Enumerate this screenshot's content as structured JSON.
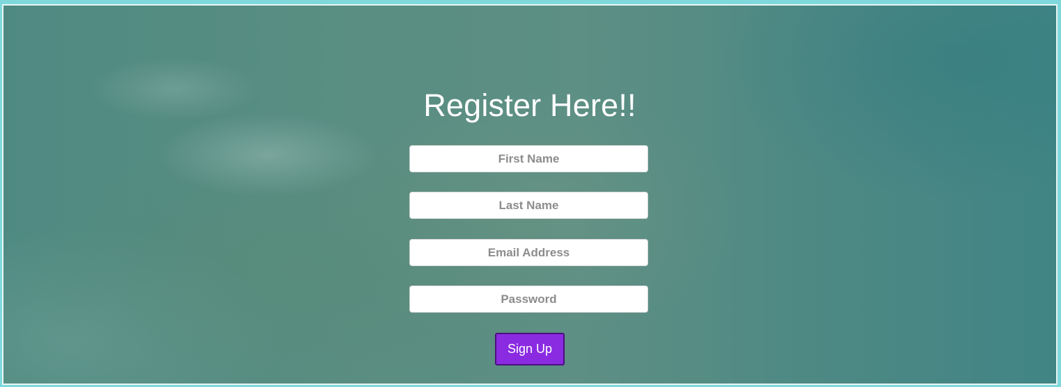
{
  "form": {
    "title": "Register Here!!",
    "fields": [
      {
        "placeholder": "First Name",
        "value": ""
      },
      {
        "placeholder": "Last Name",
        "value": ""
      },
      {
        "placeholder": "Email Address",
        "value": ""
      },
      {
        "placeholder": "Password",
        "value": ""
      }
    ],
    "submit_label": "Sign Up"
  },
  "colors": {
    "page_border": "#7fd9dc",
    "panel_background": "#4f8a82",
    "button_background": "#8a2be2",
    "button_border": "#4b0f7e",
    "title_text": "#ffffff"
  }
}
